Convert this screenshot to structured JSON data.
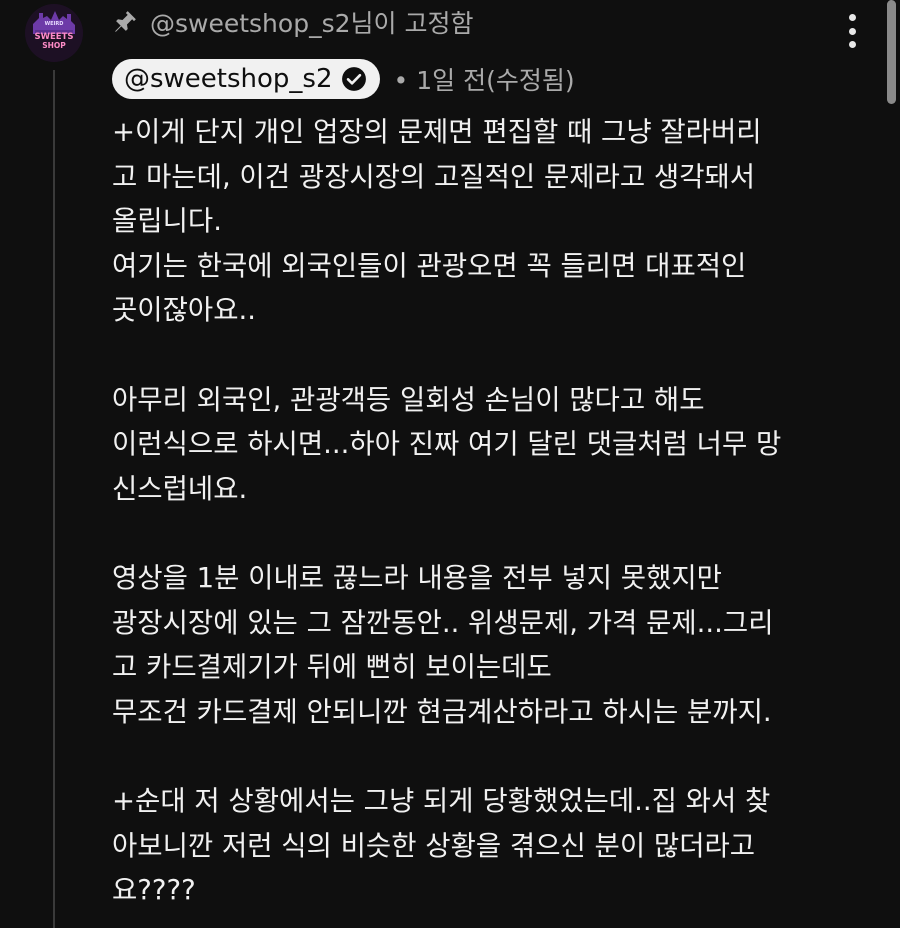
{
  "avatar": {
    "top_text": "WEIRD",
    "line1": "SWEETS",
    "line2": "SHOP"
  },
  "pinned_label": "@sweetshop_s2님이 고정함",
  "author": {
    "handle": "@sweetshop_s2",
    "meta": "• 1일 전(수정됨)"
  },
  "comment_lines": [
    "+이게 단지 개인 업장의 문제면 편집할 때 그냥 잘라버리",
    "고 마는데, 이건 광장시장의 고질적인 문제라고 생각돼서",
    "올립니다.",
    "여기는 한국에 외국인들이 관광오면 꼭 들리면 대표적인",
    "곳이잖아요..",
    "",
    "아무리 외국인, 관광객등 일회성 손님이 많다고 해도",
    "이런식으로 하시면...하아 진짜 여기 달린 댓글처럼 너무 망",
    "신스럽네요.",
    "",
    "영상을 1분 이내로 끊느라 내용을 전부 넣지 못했지만",
    "광장시장에 있는 그 잠깐동안.. 위생문제, 가격 문제...그리",
    "고 카드결제기가 뒤에 뻔히 보이는데도",
    "무조건 카드결제 안되니깐 현금계산하라고 하시는 분까지.",
    "",
    "+순대 저 상황에서는 그냥 되게 당황했었는데..집 와서 찾",
    "아보니깐 저런 식의 비슷한 상황을 겪으신 분이 많더라고",
    "요????"
  ]
}
